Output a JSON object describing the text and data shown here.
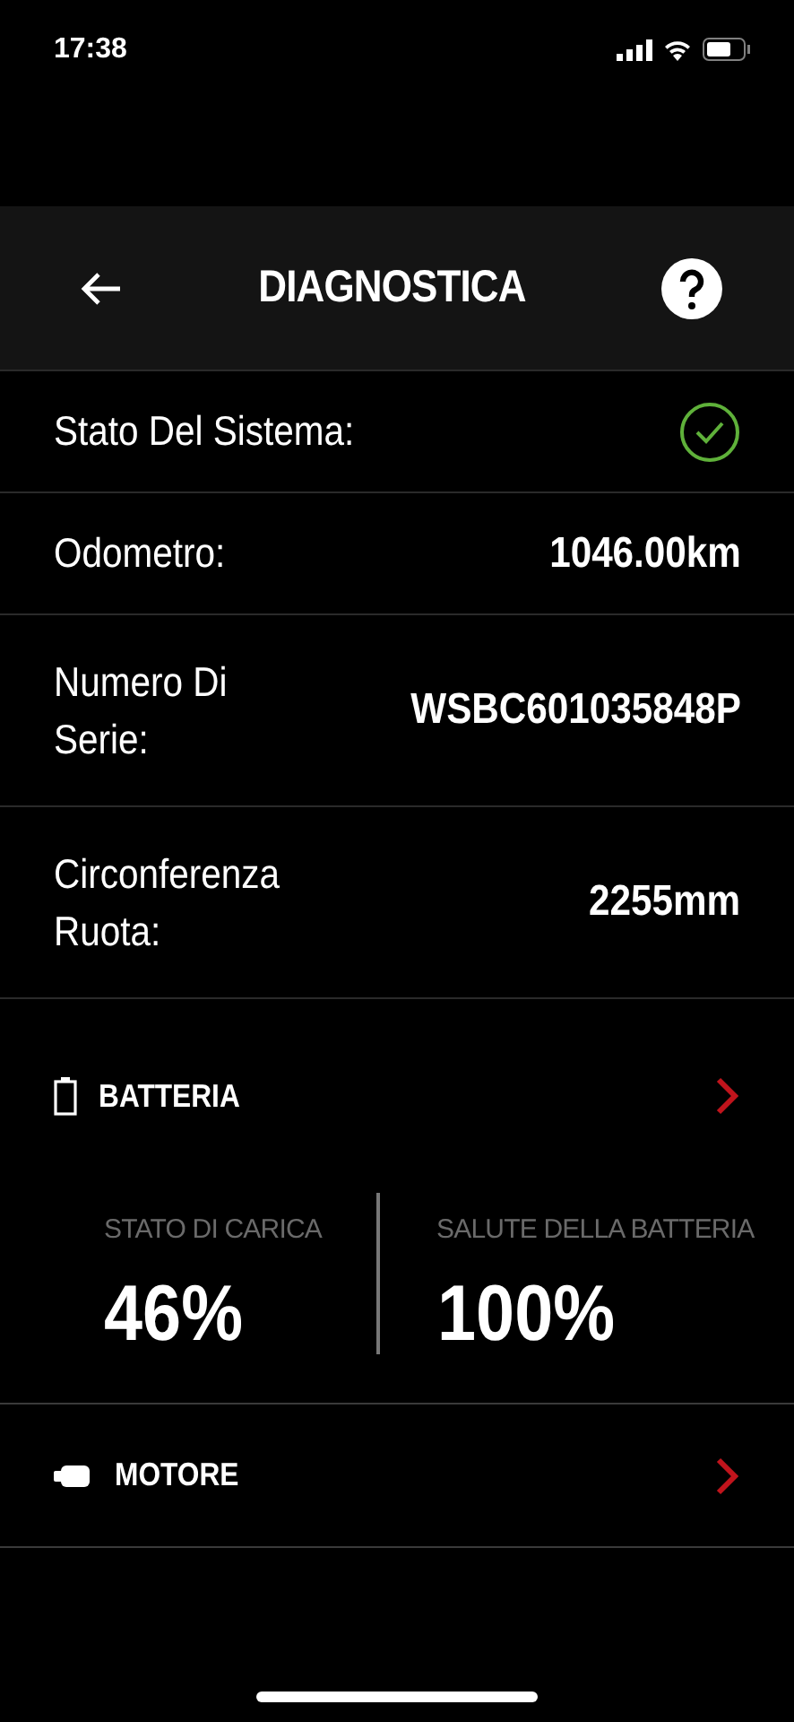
{
  "status_bar": {
    "time": "17:38"
  },
  "header": {
    "title": "DIAGNOSTICA"
  },
  "info_rows": [
    {
      "kind": "status",
      "label": "Stato Del Sistema:",
      "ok": true
    },
    {
      "kind": "text",
      "label": "Odometro:",
      "value": "1046.00km"
    },
    {
      "kind": "text",
      "label": "Numero Di\nSerie:",
      "value": "WSBC601035848P"
    },
    {
      "kind": "text",
      "label": "Circonferenza\nRuota:",
      "value": "2255mm"
    }
  ],
  "battery": {
    "title": "BATTERIA",
    "stats": [
      {
        "label": "STATO DI CARICA",
        "value": "46%"
      },
      {
        "label": "SALUTE DELLA BATTERIA",
        "value": "100%"
      }
    ]
  },
  "motor": {
    "title": "MOTORE"
  }
}
